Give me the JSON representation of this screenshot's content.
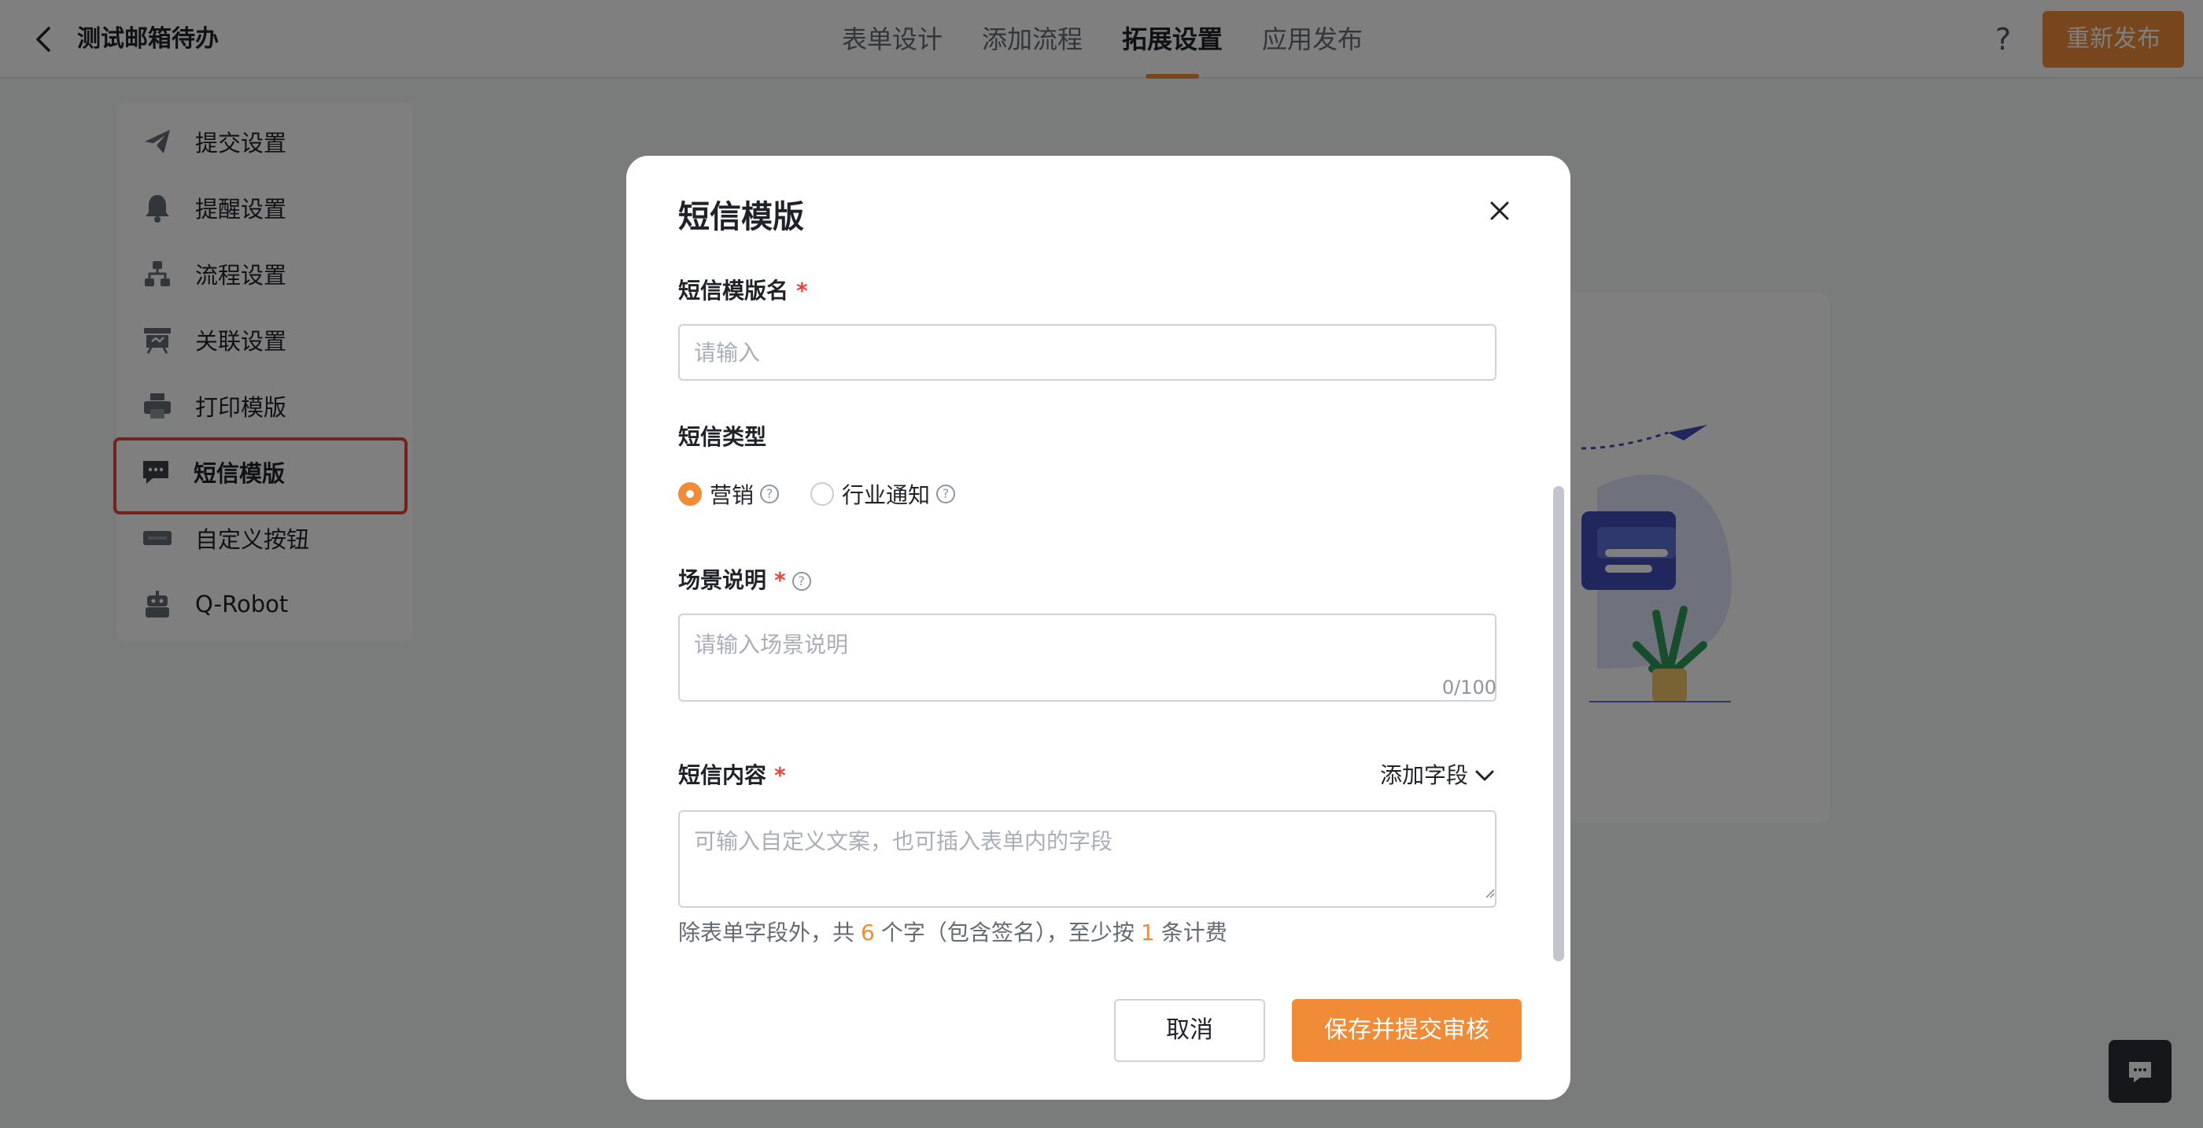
{
  "header": {
    "back_icon": "chevron-left-icon",
    "app_title": "测试邮箱待办",
    "tabs": [
      {
        "label": "表单设计"
      },
      {
        "label": "添加流程"
      },
      {
        "label": "拓展设置",
        "active": true
      },
      {
        "label": "应用发布"
      }
    ],
    "help_icon": "?",
    "publish_label": "重新发布"
  },
  "sidebar": {
    "items": [
      {
        "label": "提交设置",
        "icon": "paper-plane-icon"
      },
      {
        "label": "提醒设置",
        "icon": "bell-icon"
      },
      {
        "label": "流程设置",
        "icon": "flow-icon"
      },
      {
        "label": "关联设置",
        "icon": "link-board-icon"
      },
      {
        "label": "打印模版",
        "icon": "printer-icon"
      },
      {
        "label": "短信模版",
        "icon": "message-icon",
        "active": true
      },
      {
        "label": "自定义按钮",
        "icon": "custom-button-icon"
      },
      {
        "label": "Q-Robot",
        "icon": "robot-icon"
      }
    ]
  },
  "modal": {
    "title": "短信模版",
    "close_icon": "close-icon",
    "name_field": {
      "label": "短信模版名",
      "required": "*",
      "placeholder": "请输入",
      "value": ""
    },
    "type_field": {
      "label": "短信类型",
      "options": [
        {
          "label": "营销",
          "checked": true
        },
        {
          "label": "行业通知",
          "checked": false
        }
      ]
    },
    "scene_field": {
      "label": "场景说明",
      "required": "*",
      "placeholder": "请输入场景说明",
      "counter": "0/100"
    },
    "content_field": {
      "label": "短信内容",
      "required": "*",
      "placeholder": "可输入自定义文案，也可插入表单内的字段",
      "add_field_label": "添加字段"
    },
    "tip": {
      "prefix": "除表单字段外，共",
      "char_count": "6",
      "middle": "个字（包含签名），至少按",
      "bill_count": "1",
      "suffix": "条计费"
    },
    "cancel_label": "取消",
    "submit_label": "保存并提交审核"
  },
  "colors": {
    "accent": "#f08c38",
    "required": "#e8453c",
    "highlight_border": "#e8453c"
  }
}
